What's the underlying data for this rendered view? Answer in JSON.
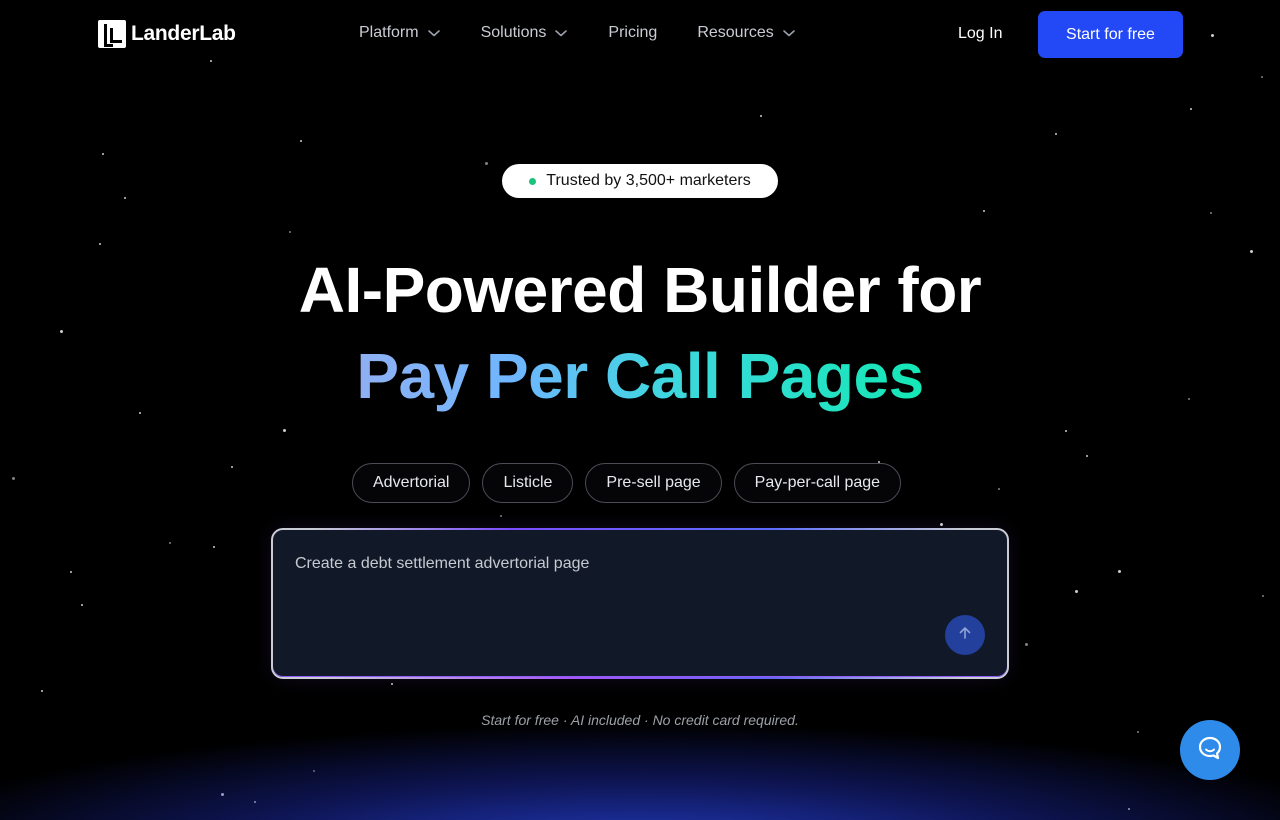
{
  "brand": {
    "name": "LanderLab"
  },
  "nav": {
    "items": [
      {
        "label": "Platform",
        "has_dropdown": true
      },
      {
        "label": "Solutions",
        "has_dropdown": true
      },
      {
        "label": "Pricing",
        "has_dropdown": false
      },
      {
        "label": "Resources",
        "has_dropdown": true
      }
    ],
    "login_label": "Log In",
    "cta_label": "Start for free"
  },
  "hero": {
    "badge_text": "Trusted by 3,500+ marketers",
    "title_line1": "AI-Powered Builder for",
    "title_line2": "Pay Per Call Pages",
    "chips": [
      "Advertorial",
      "Listicle",
      "Pre-sell page",
      "Pay-per-call page"
    ],
    "prompt_value": "Create a debt settlement advertorial page",
    "subtext": "Start for free · AI included · No credit card required."
  },
  "colors": {
    "cta_blue": "#2349f7",
    "badge_dot": "#19c37d",
    "chat_button": "#2f8bea",
    "gradient": [
      "#8fb0f2",
      "#3ed7de",
      "#14e8b5"
    ]
  },
  "icons": {
    "nav_chevron": "chevron-down-icon",
    "send": "arrow-up-icon",
    "chat": "chat-bubble-icon",
    "logo": "landerlab-logo-icon"
  }
}
